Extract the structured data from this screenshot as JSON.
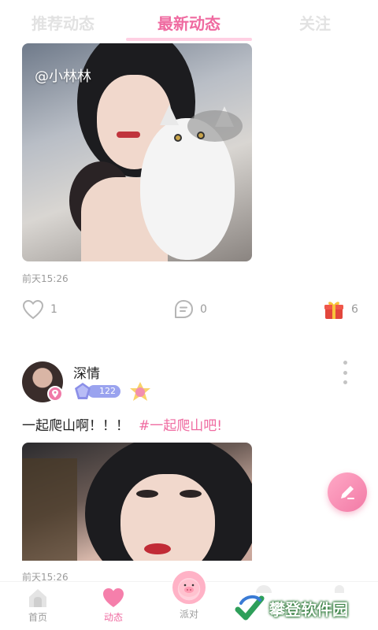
{
  "tabs": [
    {
      "label": "推荐动态",
      "active": false
    },
    {
      "label": "最新动态",
      "active": true
    },
    {
      "label": "关注",
      "active": false
    }
  ],
  "post1": {
    "photo_watermark": "@小林林",
    "time": "前天15:26",
    "likes": "1",
    "comments": "0",
    "gifts": "6"
  },
  "post2": {
    "username": "深情",
    "level": "122",
    "text": "一起爬山啊！！！",
    "tag": "#一起爬山吧!",
    "time": "前天15:26"
  },
  "nav": {
    "home": "首页",
    "moments": "动态",
    "party": "派对"
  },
  "watermark": {
    "site": "攀登软件园"
  },
  "colors": {
    "accent": "#ef6aa0",
    "inactive": "#9b9b9b",
    "tab_inactive": "#e2e2e2",
    "level": "#9aa3ef"
  },
  "icons": [
    "heart-icon",
    "comment-icon",
    "gift-icon",
    "location-icon",
    "more-icon",
    "edit-icon",
    "home-icon",
    "pig-icon",
    "check-icon"
  ]
}
